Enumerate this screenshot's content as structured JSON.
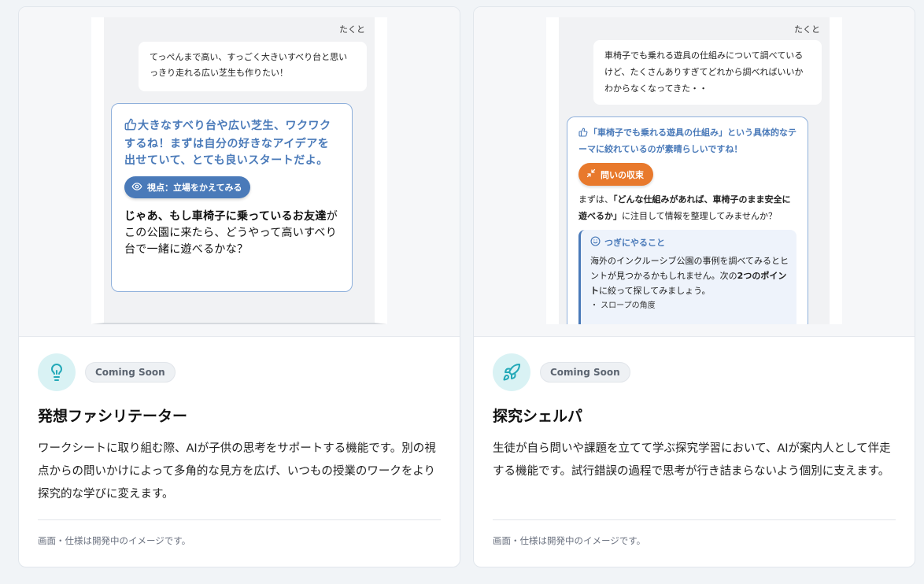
{
  "cards": [
    {
      "preview": {
        "user_name": "たくと",
        "user_message": "てっぺんまで高い、すっごく大きいすべり台と思いっきり走れる広い芝生も作りたい！",
        "ai_praise": "大きなすべり台や広い芝生、ワクワクするね！まずは自分の好きなアイデアを出せていて、とても良いスタートだよ。",
        "perspective_button": "視点：立場をかえてみる",
        "question_bold": "じゃあ、もし車椅子に乗っているお友達",
        "question_rest": "がこの公園に来たら、どうやって高いすべり台で一緒に遊べるかな？"
      },
      "icon": "lightbulb-icon",
      "badge": "Coming Soon",
      "title": "発想ファシリテーター",
      "description": "ワークシートに取り組む際、AIが子供の思考をサポートする機能です。別の視点からの問いかけによって多角的な見方を広げ、いつもの授業のワークをより探究的な学びに変えます。",
      "note": "画面・仕様は開発中のイメージです。"
    },
    {
      "preview": {
        "user_name": "たくと",
        "user_message": "車椅子でも乗れる遊具の仕組みについて調べているけど、たくさんありすぎてどれから調べればいいかわからなくなってきた・・",
        "ai_praise": "「車椅子でも乗れる遊具の仕組み」という具体的なテーマに絞れているのが素晴らしいですね！",
        "converge_button": "問いの収束",
        "body_pre": "まずは、",
        "body_bold": "「どんな仕組みがあれば、車椅子のまま安全に遊べるか」",
        "body_post": "に注目して情報を整理してみませんか？",
        "next_title": "つぎにやること",
        "next_body_pre": "海外のインクルーシブ公園の事例を調べてみるとヒントが見つかるかもしれません。次の",
        "next_body_bold": "2つのポイント",
        "next_body_post": "に絞って探してみましょう。",
        "next_bullet": "・ スロープの角度"
      },
      "icon": "rocket-icon",
      "badge": "Coming Soon",
      "title": "探究シェルパ",
      "description": "生徒が自ら問いや課題を立てて学ぶ探究学習において、AIが案内人として伴走する機能です。試行錯誤の過程で思考が行き詰まらないよう個別に支えます。",
      "note": "画面・仕様は開発中のイメージです。"
    }
  ],
  "colors": {
    "accent_blue": "#4a7ab9",
    "accent_orange": "#e8792c",
    "icon_bg": "#d9f2f4",
    "icon_fg": "#23a9b8"
  }
}
